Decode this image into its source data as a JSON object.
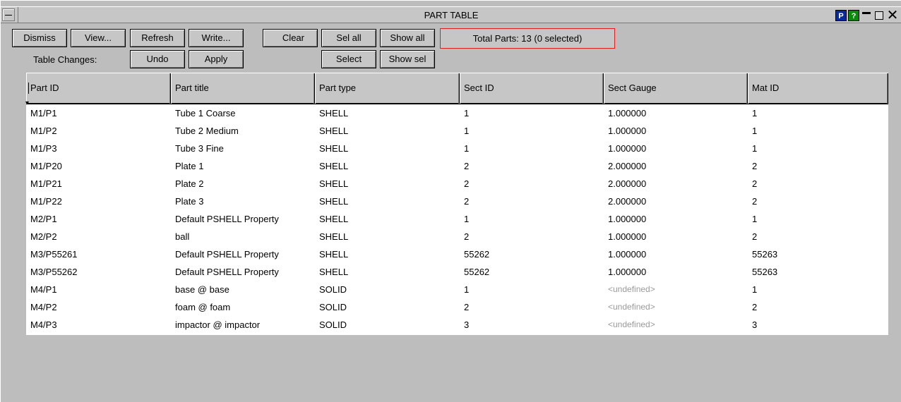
{
  "window": {
    "title": "PART TABLE",
    "icons": {
      "p_label": "P",
      "help_label": "?",
      "close_label": "✕"
    }
  },
  "toolbar": {
    "dismiss": "Dismiss",
    "view": "View...",
    "refresh": "Refresh",
    "write": "Write...",
    "clear": "Clear",
    "sel_all": "Sel all",
    "show_all": "Show all",
    "status": "Total Parts: 13 (0 selected)",
    "table_changes_label": "Table Changes:",
    "undo": "Undo",
    "apply": "Apply",
    "select": "Select",
    "show_sel": "Show sel"
  },
  "table": {
    "columns": [
      "Part ID",
      "Part title",
      "Part type",
      "Sect ID",
      "Sect Gauge",
      "Mat ID"
    ],
    "rows": [
      [
        "M1/P1",
        "Tube 1 Coarse",
        "SHELL",
        "1",
        "1.000000",
        "1"
      ],
      [
        "M1/P2",
        "Tube 2 Medium",
        "SHELL",
        "1",
        "1.000000",
        "1"
      ],
      [
        "M1/P3",
        "Tube 3  Fine",
        "SHELL",
        "1",
        "1.000000",
        "1"
      ],
      [
        "M1/P20",
        "Plate 1",
        "SHELL",
        "2",
        "2.000000",
        "2"
      ],
      [
        "M1/P21",
        "Plate 2",
        "SHELL",
        "2",
        "2.000000",
        "2"
      ],
      [
        "M1/P22",
        "Plate 3",
        "SHELL",
        "2",
        "2.000000",
        "2"
      ],
      [
        "M2/P1",
        "Default PSHELL Property",
        "SHELL",
        "1",
        "1.000000",
        "1"
      ],
      [
        "M2/P2",
        "ball",
        "SHELL",
        "2",
        "1.000000",
        "2"
      ],
      [
        "M3/P55261",
        "Default PSHELL Property",
        "SHELL",
        "55262",
        "1.000000",
        "55263"
      ],
      [
        "M3/P55262",
        "Default PSHELL Property",
        "SHELL",
        "55262",
        "1.000000",
        "55263"
      ],
      [
        "M4/P1",
        "base @ base",
        "SOLID",
        "1",
        "<undefined>",
        "1"
      ],
      [
        "M4/P2",
        "foam @ foam",
        "SOLID",
        "2",
        "<undefined>",
        "2"
      ],
      [
        "M4/P3",
        "impactor @ impactor",
        "SOLID",
        "3",
        "<undefined>",
        "3"
      ]
    ]
  }
}
